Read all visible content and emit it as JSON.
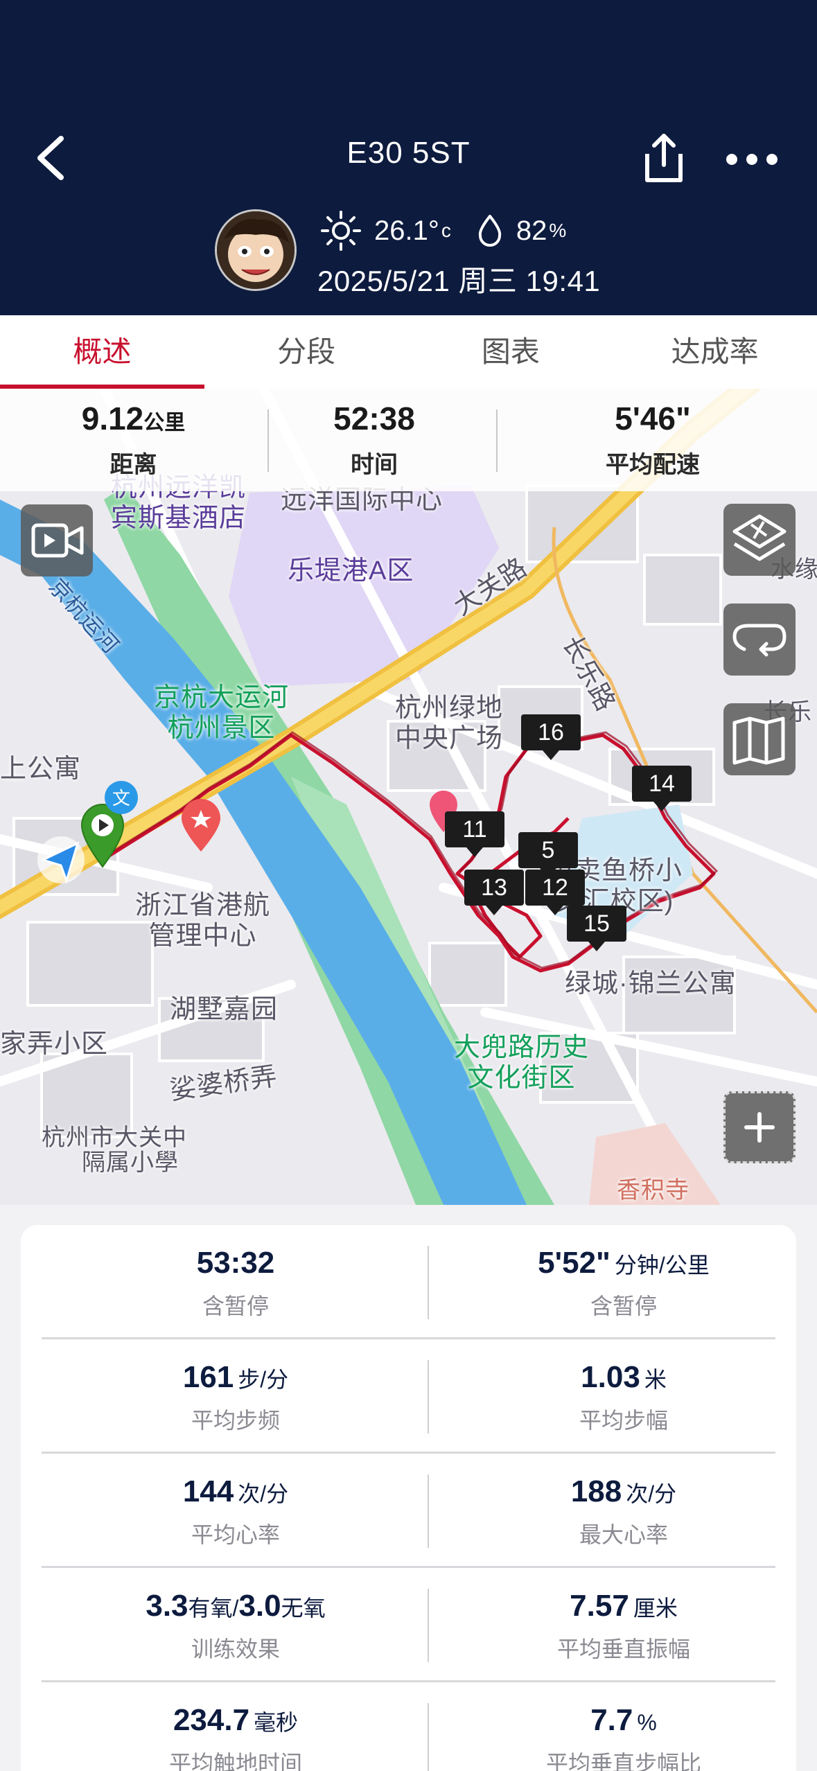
{
  "header": {
    "title": "E30 5ST",
    "temperature": "26.1°",
    "temperature_unit": "c",
    "humidity": "82",
    "humidity_unit": "%",
    "datetime": "2025/5/21 周三 19:41",
    "bg_color": "#0d1b3e",
    "icons": [
      "back-arrow-icon",
      "share-icon",
      "more-icon",
      "sun-icon",
      "water-drop-icon"
    ]
  },
  "tabs": [
    {
      "label": "概述",
      "active": true
    },
    {
      "label": "分段",
      "active": false
    },
    {
      "label": "图表",
      "active": false
    },
    {
      "label": "达成率",
      "active": false
    }
  ],
  "accent_color": "#c8102e",
  "summary": {
    "distance": {
      "value": "9.12",
      "unit": "公里",
      "label": "距离"
    },
    "time": {
      "value": "52:38",
      "label": "时间"
    },
    "pace": {
      "value": "5'46\"",
      "label": "平均配速"
    }
  },
  "map": {
    "labels": {
      "hotel": "杭州远洋凯\n宾斯基酒店",
      "center": "远洋国际中心",
      "letigang": "乐堤港A区",
      "daguan_road": "大关路",
      "jinghang_canal": "京杭运河",
      "canal_scenic": "京杭大运河\n杭州景区",
      "greenland": "杭州绿地\n中央广场",
      "changle_road": "长乐路",
      "apartment": "上公寓",
      "port_center": "浙江省港航\n管理中心",
      "fish_school": "市卖鱼桥小\n文汇校区)",
      "jinlan": "绿城·锦兰公寓",
      "huzhu": "湖墅嘉园",
      "xiaoqu": "家弄小区",
      "dadou": "大兜路历史\n文化街区",
      "suopo": "娑婆桥弄",
      "daguan_middle": "杭州市大关中",
      "school_frag": "隔属小學",
      "right_frag1": "水缘",
      "right_frag2": "长乐",
      "bottom_frag": "香积寺"
    },
    "km_markers": [
      "16",
      "14",
      "11",
      "5",
      "13",
      "12",
      "15"
    ],
    "icons": [
      "video-icon",
      "layers-icon",
      "loop-icon",
      "map-book-icon",
      "zoom-in-icon",
      "start-flag-icon",
      "location-arrow-icon"
    ]
  },
  "stats": [
    {
      "left": {
        "value": "53:32",
        "unit": "",
        "label": "含暂停"
      },
      "right": {
        "value": "5'52\"",
        "unit": "分钟/公里",
        "label": "含暂停"
      }
    },
    {
      "left": {
        "value": "161",
        "unit": "步/分",
        "label": "平均步频"
      },
      "right": {
        "value": "1.03",
        "unit": "米",
        "label": "平均步幅"
      }
    },
    {
      "left": {
        "value": "144",
        "unit": "次/分",
        "label": "平均心率"
      },
      "right": {
        "value": "188",
        "unit": "次/分",
        "label": "最大心率"
      }
    },
    {
      "left": {
        "value_a": "3.3",
        "unit_a": "有氧/",
        "value_b": "3.0",
        "unit_b": "无氧",
        "label": "训练效果"
      },
      "right": {
        "value": "7.57",
        "unit": "厘米",
        "label": "平均垂直振幅"
      }
    },
    {
      "left": {
        "value": "234.7",
        "unit": "毫秒",
        "label": "平均触地时间"
      },
      "right": {
        "value": "7.7",
        "unit": "%",
        "label": "平均垂直步幅比"
      }
    }
  ]
}
